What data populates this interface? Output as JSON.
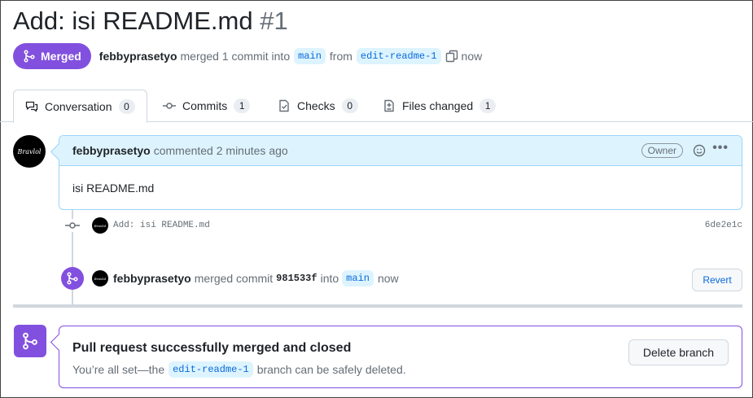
{
  "pr": {
    "title": "Add: isi README.md",
    "number": "#1",
    "state_label": "Merged",
    "author": "febbyprasetyo",
    "merged_text": "merged 1 commit into",
    "base_branch": "main",
    "from_text": "from",
    "head_branch": "edit-readme-1",
    "time": "now"
  },
  "tabs": [
    {
      "label": "Conversation",
      "count": "0",
      "icon": "comment-discussion-icon"
    },
    {
      "label": "Commits",
      "count": "1",
      "icon": "git-commit-icon"
    },
    {
      "label": "Checks",
      "count": "0",
      "icon": "checklist-icon"
    },
    {
      "label": "Files changed",
      "count": "1",
      "icon": "file-diff-icon"
    }
  ],
  "comment": {
    "author": "febbyprasetyo",
    "action": "commented 2 minutes ago",
    "badge": "Owner",
    "body": "isi README.md",
    "more": "•••"
  },
  "commit": {
    "message": "Add: isi README.md",
    "sha": "6de2e1c"
  },
  "merge_event": {
    "author": "febbyprasetyo",
    "text1": "merged commit",
    "sha": "981533f",
    "text2": "into",
    "branch": "main",
    "time": "now",
    "revert_label": "Revert"
  },
  "merged_box": {
    "title": "Pull request successfully merged and closed",
    "sub_before": "You’re all set—the",
    "branch": "edit-readme-1",
    "sub_after": "branch can be safely deleted.",
    "delete_label": "Delete branch"
  },
  "avatar_text": "Bravlol",
  "colors": {
    "merged": "#8250df",
    "link": "#0969da",
    "branch_bg": "#ddf4ff",
    "comment_border": "#9cd4f5"
  }
}
